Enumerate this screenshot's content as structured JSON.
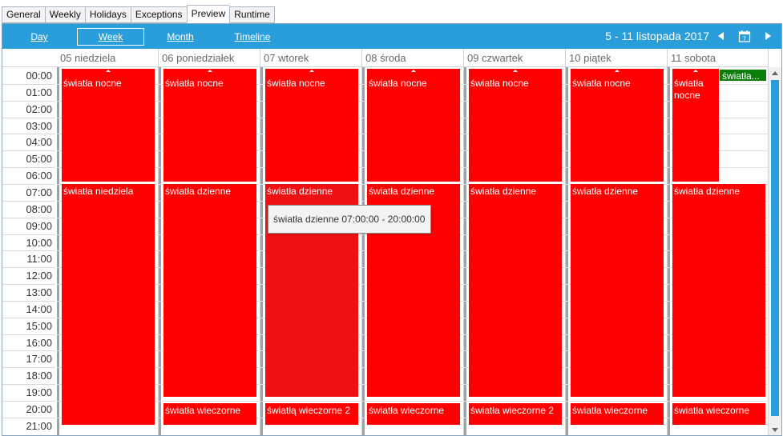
{
  "tabs": [
    "General",
    "Weekly",
    "Holidays",
    "Exceptions",
    "Preview",
    "Runtime"
  ],
  "active_tab": "Preview",
  "toolbar": {
    "views": [
      "Day",
      "Week",
      "Month",
      "Timeline"
    ],
    "active_view": "Week",
    "date_range": "5  - 11 listopada 2017",
    "icons": [
      "prev-icon",
      "calendar-icon",
      "next-icon"
    ],
    "accent": "#2a9ddb"
  },
  "days": [
    "05 niedziela",
    "06 poniedziałek",
    "07 wtorek",
    "08 środa",
    "09 czwartek",
    "10 piątek",
    "11 sobota"
  ],
  "hours": [
    "00:00",
    "01:00",
    "02:00",
    "03:00",
    "04:00",
    "05:00",
    "06:00",
    "07:00",
    "08:00",
    "09:00",
    "10:00",
    "11:00",
    "12:00",
    "13:00",
    "14:00",
    "15:00",
    "16:00",
    "17:00",
    "18:00",
    "19:00",
    "20:00",
    "21:00"
  ],
  "events": [
    {
      "day": 0,
      "label": "światła nocne"
    },
    {
      "day": 0,
      "label": "światła niedziela"
    },
    {
      "day": 1,
      "label": "światła nocne"
    },
    {
      "day": 1,
      "label": "światła dzienne"
    },
    {
      "day": 1,
      "label": "światła wieczorne"
    },
    {
      "day": 2,
      "label": "światła nocne"
    },
    {
      "day": 2,
      "label": "światła dzienne"
    },
    {
      "day": 2,
      "label": "światłą wieczorne 2"
    },
    {
      "day": 3,
      "label": "światła nocne"
    },
    {
      "day": 3,
      "label": "światła dzienne"
    },
    {
      "day": 3,
      "label": "światła wieczorne"
    },
    {
      "day": 4,
      "label": "światła nocne"
    },
    {
      "day": 4,
      "label": "światła dzienne"
    },
    {
      "day": 4,
      "label": "światła wieczorne 2"
    },
    {
      "day": 5,
      "label": "światła nocne"
    },
    {
      "day": 5,
      "label": "światła dzienne"
    },
    {
      "day": 5,
      "label": "światła wieczorne"
    },
    {
      "day": 6,
      "label": "światła nocne"
    },
    {
      "day": 6,
      "label": "światła..."
    },
    {
      "day": 6,
      "label": "światła dzienne"
    },
    {
      "day": 6,
      "label": "światła wieczorne"
    }
  ],
  "tooltip": "światła dzienne  07:00:00 - 20:00:00",
  "colors": {
    "event": "#ff0000",
    "event_alt": "#0a7e07",
    "accent": "#2a9ddb"
  }
}
